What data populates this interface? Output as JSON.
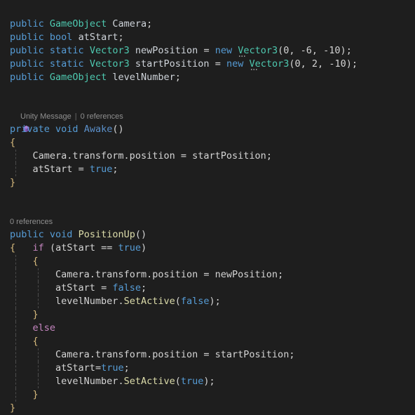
{
  "editor": {
    "background": "#1e1e1e",
    "font_size_px": 13.5,
    "line_height_px": 19,
    "language": "csharp",
    "colors": {
      "keyword": "#569cd6",
      "type": "#4ec9b0",
      "identifier": "#d4d4d4",
      "method": "#dcdcaa",
      "unity_message_method": "#5b8fc9",
      "control_keyword": "#c586c0",
      "number": "#b5cea8",
      "bracket": "#d7ba7d",
      "codelens_text": "#8f8f8f",
      "unity_icon": "#8a5fbf"
    }
  },
  "codelens": [
    {
      "id": "awake-codelens",
      "icon": "unity-cube-icon",
      "label": "Unity Message",
      "separator": "|",
      "references": "0 references"
    },
    {
      "id": "positionup-codelens",
      "icon": null,
      "label": null,
      "separator": null,
      "references": "0 references"
    }
  ],
  "code": {
    "fields": {
      "line1": {
        "kw_public": "public",
        "type": "GameObject",
        "name": "Camera",
        "semi": ";"
      },
      "line2": {
        "kw_public": "public",
        "type": "bool",
        "name": "atStart",
        "semi": ";"
      },
      "line3": {
        "kw_public": "public",
        "kw_static": "static",
        "type": "Vector3",
        "name": "newPosition",
        "assign": "=",
        "kw_new": "new",
        "ctor": "Vector3",
        "args": "(0, -6, -10)",
        "semi": ";"
      },
      "line4": {
        "kw_public": "public",
        "kw_static": "static",
        "type": "Vector3",
        "name": "startPosition",
        "assign": "=",
        "kw_new": "new",
        "ctor": "Vector3",
        "args": "(0, 2, -10)",
        "semi": ";"
      },
      "line5": {
        "kw_public": "public",
        "type": "GameObject",
        "name": "levelNumber",
        "semi": ";"
      }
    },
    "awake": {
      "modifier": "private",
      "return_type": "void",
      "name": "Awake",
      "parens": "()",
      "open_brace": "{",
      "close_brace": "}",
      "body": {
        "stmt1_target": "Camera.transform.position",
        "stmt1_assign": "=",
        "stmt1_value": "startPosition",
        "stmt1_semi": ";",
        "stmt2_target": "atStart",
        "stmt2_assign": "=",
        "stmt2_value": "true",
        "stmt2_semi": ";"
      }
    },
    "position_up": {
      "modifier": "public",
      "return_type": "void",
      "name": "PositionUp",
      "parens": "()",
      "open_brace": "{",
      "close_brace": "}",
      "if_keyword": "if",
      "if_condition": "(atStart == true)",
      "if_cond_open": "(",
      "if_cond_ident": "atStart",
      "if_cond_op": "==",
      "if_cond_value": "true",
      "if_cond_close": ")",
      "if_open_brace": "{",
      "if_close_brace": "}",
      "else_keyword": "else",
      "else_open_brace": "{",
      "else_close_brace": "}",
      "if_body": {
        "stmt1_target": "Camera.transform.position",
        "stmt1_assign": "=",
        "stmt1_value": "newPosition",
        "stmt1_semi": ";",
        "stmt2_target": "atStart",
        "stmt2_assign": "=",
        "stmt2_value": "false",
        "stmt2_semi": ";",
        "stmt3_target": "levelNumber",
        "stmt3_dot": ".",
        "stmt3_method": "SetActive",
        "stmt3_open": "(",
        "stmt3_arg": "false",
        "stmt3_close": ")",
        "stmt3_semi": ";"
      },
      "else_body": {
        "stmt1_target": "Camera.transform.position",
        "stmt1_assign": "=",
        "stmt1_value": "startPosition",
        "stmt1_semi": ";",
        "stmt2_target": "atStart",
        "stmt2_assign": "=",
        "stmt2_value": "true",
        "stmt2_semi": ";",
        "stmt3_target": "levelNumber",
        "stmt3_dot": ".",
        "stmt3_method": "SetActive",
        "stmt3_open": "(",
        "stmt3_arg": "true",
        "stmt3_close": ")",
        "stmt3_semi": ";"
      }
    }
  }
}
